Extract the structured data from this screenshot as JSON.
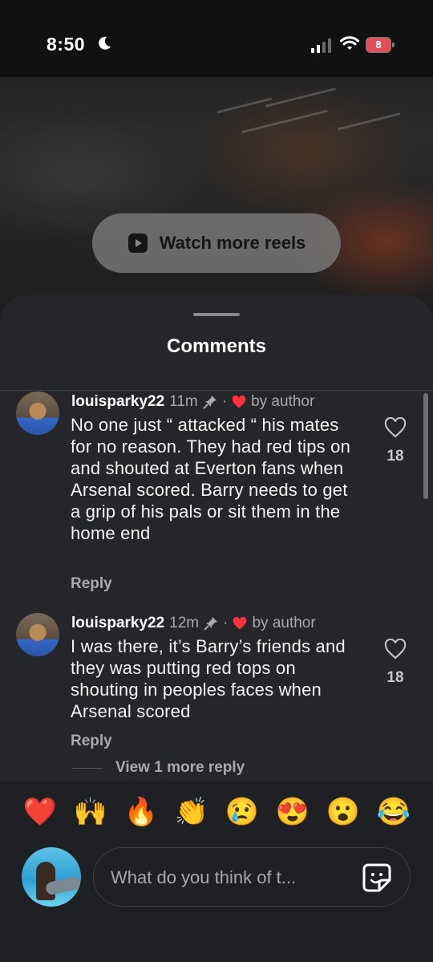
{
  "status_bar": {
    "time": "8:50",
    "battery": "8"
  },
  "video": {
    "watch_more_label": "Watch more reels"
  },
  "comments_sheet": {
    "title": "Comments",
    "comments": [
      {
        "username": "louisparky22",
        "time": "11m",
        "liked_by": "by author",
        "text": "No one just “ attacked “ his mates for no reason. They had red tips on and shouted at Everton fans when Arsenal scored. Barry needs to get a grip of his pals or sit them in the home end",
        "reply_label": "Reply",
        "likes": "18"
      },
      {
        "username": "louisparky22",
        "time": "12m",
        "liked_by": "by author",
        "text": "I was there, it’s Barry’s friends and they was putting red tops on shouting in peoples faces when Arsenal scored",
        "reply_label": "Reply",
        "likes": "18"
      }
    ],
    "view_more_replies": "View 1 more reply"
  },
  "composer": {
    "reactions": [
      "❤️",
      "🙌",
      "🔥",
      "👏",
      "😢",
      "😍",
      "😮",
      "😂"
    ],
    "placeholder": "What do you think of t..."
  },
  "colors": {
    "sheet_bg": "#252629",
    "like_heart": "#ff3040",
    "battery_low": "#e0505a"
  }
}
